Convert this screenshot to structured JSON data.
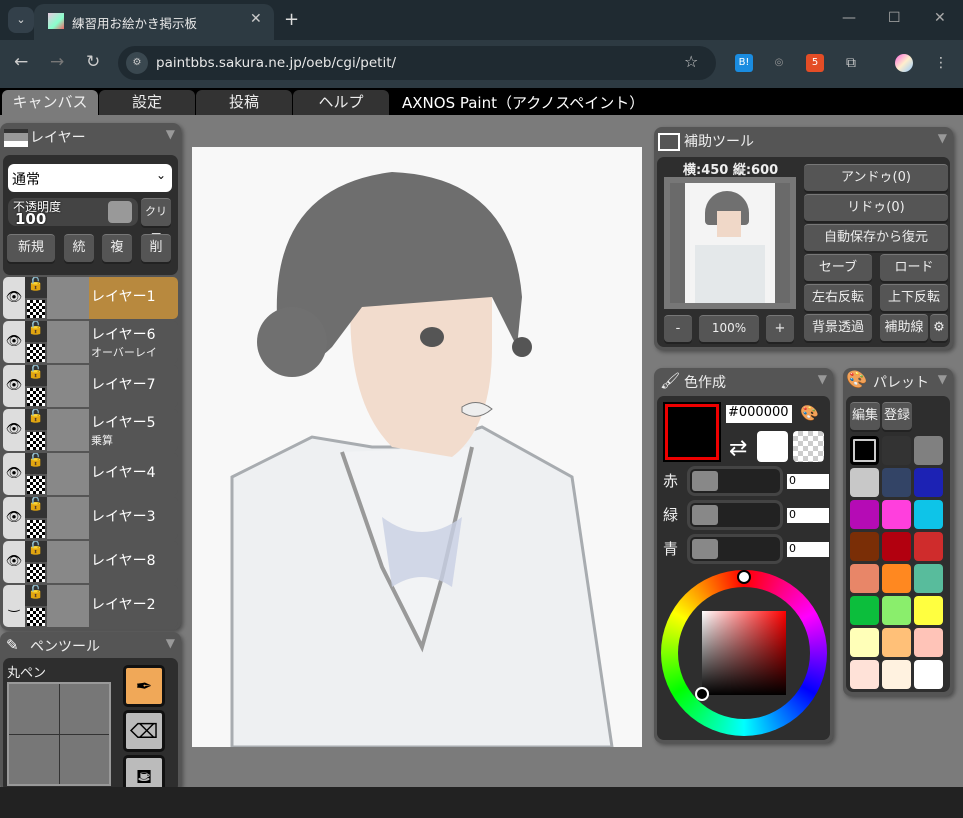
{
  "browser": {
    "tab_title": "練習用お絵かき掲示板",
    "url": "paintbbs.sakura.ne.jp/oeb/cgi/petit/",
    "icons": [
      "tab-search-icon",
      "close-icon",
      "new-tab-icon",
      "minimize-icon",
      "maximize-icon",
      "close-window-icon",
      "back-icon",
      "forward-icon",
      "reload-icon",
      "site-info-icon",
      "bookmark-star-icon",
      "hatena-bookmark-icon",
      "mouse-icon",
      "html5-icon",
      "extensions-icon",
      "profile-avatar",
      "more-icon"
    ],
    "ext_hatena": "B!"
  },
  "app": {
    "tabs": [
      "キャンバス",
      "設定",
      "投稿",
      "ヘルプ"
    ],
    "active_tab": "キャンバス",
    "title": "AXNOS Paint（アクノスペイント）"
  },
  "layers_panel": {
    "title": "レイヤー",
    "blend_mode": "通常",
    "opacity_label": "不透明度",
    "opacity_value": "100",
    "clear_label": "クリア",
    "buttons": [
      "新規",
      "統",
      "複",
      "削"
    ],
    "layers": [
      {
        "name": "レイヤー1",
        "mode": "",
        "selected": true,
        "visible": true
      },
      {
        "name": "レイヤー6",
        "mode": "オーバーレイ",
        "selected": false,
        "visible": true
      },
      {
        "name": "レイヤー7",
        "mode": "",
        "selected": false,
        "visible": true
      },
      {
        "name": "レイヤー5",
        "mode": "乗算",
        "selected": false,
        "visible": true
      },
      {
        "name": "レイヤー4",
        "mode": "",
        "selected": false,
        "visible": true
      },
      {
        "name": "レイヤー3",
        "mode": "",
        "selected": false,
        "visible": true
      },
      {
        "name": "レイヤー8",
        "mode": "",
        "selected": false,
        "visible": true
      },
      {
        "name": "レイヤー2",
        "mode": "",
        "selected": false,
        "visible": false
      }
    ],
    "selected_color": "#b8893e"
  },
  "pen_panel": {
    "title": "ペンツール",
    "pen_name": "丸ペン",
    "tools": [
      "pen-icon",
      "eraser-icon",
      "bucket-icon"
    ]
  },
  "aux_panel": {
    "title": "補助ツール",
    "size_text": "横:450 縦:600",
    "undo": "アンドゥ(0)",
    "redo": "リドゥ(0)",
    "restore": "自動保存から復元",
    "save": "セーブ",
    "load": "ロード",
    "flip_h": "左右反転",
    "flip_v": "上下反転",
    "zoom_out": "-",
    "zoom": "100%",
    "zoom_in": "+",
    "bg_transparent": "背景透過",
    "guide": "補助線"
  },
  "color_panel": {
    "title": "色作成",
    "hex": "#000000",
    "main_color": "#000000",
    "sub_color": "#ffffff",
    "labels": {
      "r": "赤",
      "g": "緑",
      "b": "青"
    },
    "values": {
      "r": "0",
      "g": "0",
      "b": "0"
    }
  },
  "palette_panel": {
    "title": "パレット",
    "edit": "編集",
    "register": "登録",
    "colors": [
      "#000000",
      "#333333",
      "#808080",
      "#c8c8c8",
      "#334466",
      "#1c22b4",
      "#b50bb5",
      "#ff3fdd",
      "#0ec4e8",
      "#7a2e06",
      "#b2000f",
      "#cf2c2c",
      "#e88668",
      "#ff8820",
      "#58bc9c",
      "#0cbe3c",
      "#8aee6c",
      "#ffff40",
      "#ffffb8",
      "#ffc078",
      "#ffc4b8",
      "#ffe2d8",
      "#fff2e0",
      "#ffffff"
    ]
  }
}
